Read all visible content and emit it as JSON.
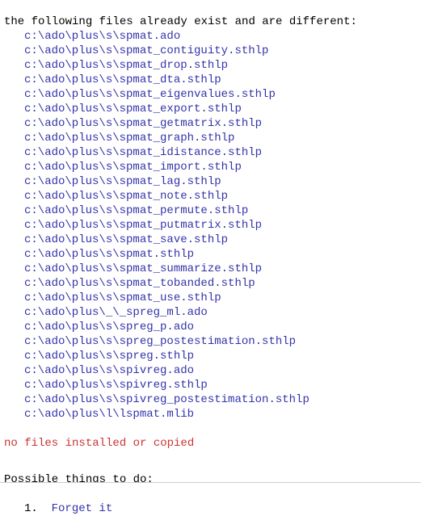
{
  "console": {
    "header_message": "the following files already exist and are different:",
    "file_paths": [
      "c:\\ado\\plus\\s\\spmat.ado",
      "c:\\ado\\plus\\s\\spmat_contiguity.sthlp",
      "c:\\ado\\plus\\s\\spmat_drop.sthlp",
      "c:\\ado\\plus\\s\\spmat_dta.sthlp",
      "c:\\ado\\plus\\s\\spmat_eigenvalues.sthlp",
      "c:\\ado\\plus\\s\\spmat_export.sthlp",
      "c:\\ado\\plus\\s\\spmat_getmatrix.sthlp",
      "c:\\ado\\plus\\s\\spmat_graph.sthlp",
      "c:\\ado\\plus\\s\\spmat_idistance.sthlp",
      "c:\\ado\\plus\\s\\spmat_import.sthlp",
      "c:\\ado\\plus\\s\\spmat_lag.sthlp",
      "c:\\ado\\plus\\s\\spmat_note.sthlp",
      "c:\\ado\\plus\\s\\spmat_permute.sthlp",
      "c:\\ado\\plus\\s\\spmat_putmatrix.sthlp",
      "c:\\ado\\plus\\s\\spmat_save.sthlp",
      "c:\\ado\\plus\\s\\spmat.sthlp",
      "c:\\ado\\plus\\s\\spmat_summarize.sthlp",
      "c:\\ado\\plus\\s\\spmat_tobanded.sthlp",
      "c:\\ado\\plus\\s\\spmat_use.sthlp",
      "c:\\ado\\plus\\_\\_spreg_ml.ado",
      "c:\\ado\\plus\\s\\spreg_p.ado",
      "c:\\ado\\plus\\s\\spreg_postestimation.sthlp",
      "c:\\ado\\plus\\s\\spreg.sthlp",
      "c:\\ado\\plus\\s\\spivreg.ado",
      "c:\\ado\\plus\\s\\spivreg.sthlp",
      "c:\\ado\\plus\\s\\spivreg_postestimation.sthlp",
      "c:\\ado\\plus\\l\\lspmat.mlib"
    ],
    "error_message": "no files installed or copied",
    "todo_heading": "Possible things to do:",
    "todo_items": [
      {
        "number": "1.",
        "label": "Forget it"
      }
    ]
  },
  "colors": {
    "text": "#000000",
    "link": "#3333aa",
    "error": "#cc3333",
    "background": "#ffffff",
    "divider": "#cdcdcd"
  }
}
